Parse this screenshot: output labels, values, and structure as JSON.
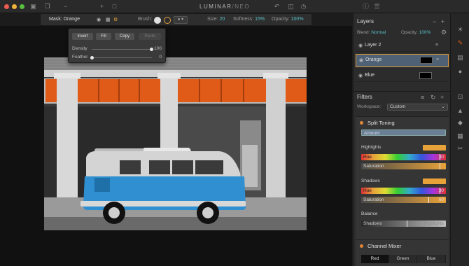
{
  "app": {
    "title": "LUMINAR",
    "title_suffix": "NEO",
    "title_separator": "/"
  },
  "toolbar": {
    "mask_label": "Mask: Orange",
    "brush_label": "Brush:",
    "size_label": "Size:",
    "size_value": "20",
    "softness_label": "Softness:",
    "softness_value": "15%",
    "opacity_label": "Opacity:",
    "opacity_value": "100%"
  },
  "mask_popup": {
    "buttons": [
      "Invert",
      "Fill",
      "Copy",
      "Paste"
    ],
    "density_label": "Density",
    "density_value": "100",
    "feather_label": "Feather",
    "feather_value": "0"
  },
  "layers_panel": {
    "title": "Layers",
    "blend_label": "Blend:",
    "blend_value": "Normal",
    "opacity_label": "Opacity:",
    "opacity_value": "100%",
    "layers": [
      {
        "name": "Layer 2"
      },
      {
        "name": "Orange",
        "selected": true
      },
      {
        "name": "Blue"
      }
    ]
  },
  "filters_panel": {
    "title": "Filters",
    "workspace_label": "Workspace:",
    "workspace_value": "Custom",
    "split_toning": {
      "title": "Split Toning",
      "amount_label": "Amount",
      "highlights_label": "Highlights",
      "highlights_hue_label": "Hue",
      "highlights_hue_value": "30",
      "highlights_saturation_label": "Saturation",
      "shadows_label": "Shadows",
      "shadows_hue_label": "Hue",
      "shadows_hue_value": "30",
      "shadows_saturation_label": "Saturation",
      "shadows_saturation_value": "60",
      "balance_label": "Balance",
      "balance_shadows_label": "Shadows",
      "balance_highlights_label": "Highlights"
    },
    "channel_mixer": {
      "title": "Channel Mixer",
      "channels": [
        "Red",
        "Green",
        "Blue"
      ],
      "active_channel": "Red"
    }
  },
  "colors": {
    "accent_orange": "#e8a23a",
    "accent_teal": "#58c0c8",
    "layer_selected": "#4f6275",
    "bus_blue": "#2f8fd0",
    "window_orange": "#e05a18"
  }
}
